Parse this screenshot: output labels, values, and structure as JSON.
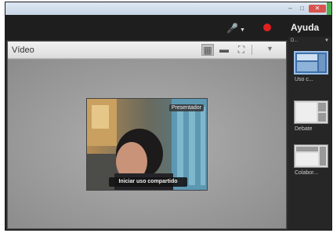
{
  "window": {
    "controls": {
      "minimize": "–",
      "maximize": "□",
      "close": "✕"
    }
  },
  "topbar": {
    "mic_icon": "microphone-icon",
    "record_icon": "record-icon",
    "help_label": "Ayuda"
  },
  "pod": {
    "title": "Vídeo",
    "view_buttons": [
      "grid-view-icon",
      "single-view-icon",
      "fullscreen-icon"
    ],
    "menu_icon": "pod-menu-icon"
  },
  "video": {
    "presenter_tag": "Presentador",
    "share_button": "Iniciar uso compartido"
  },
  "sidebar": {
    "header": "D...",
    "layouts": [
      {
        "label": "Uso c...",
        "selected": true
      },
      {
        "label": "Debate",
        "selected": false
      },
      {
        "label": "Colabor...",
        "selected": false
      }
    ]
  },
  "colors": {
    "accent_red": "#e02020",
    "selected_layout": "#3f6fa8"
  }
}
